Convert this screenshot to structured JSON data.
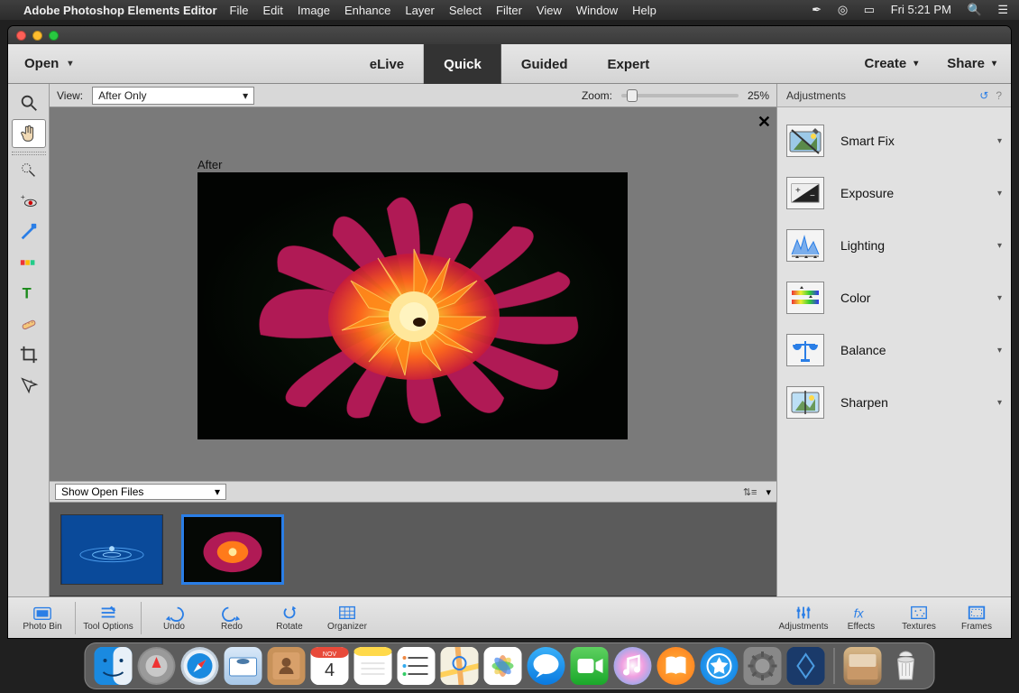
{
  "menubar": {
    "appname": "Adobe Photoshop Elements Editor",
    "items": [
      "File",
      "Edit",
      "Image",
      "Enhance",
      "Layer",
      "Select",
      "Filter",
      "View",
      "Window",
      "Help"
    ],
    "clock": "Fri 5:21 PM"
  },
  "toolbar": {
    "open_label": "Open",
    "modes": [
      "eLive",
      "Quick",
      "Guided",
      "Expert"
    ],
    "active_mode": "Quick",
    "create_label": "Create",
    "share_label": "Share"
  },
  "viewbar": {
    "label": "View:",
    "selected": "After Only",
    "zoom_label": "Zoom:",
    "zoom_value": "25%"
  },
  "canvas": {
    "after_label": "After"
  },
  "binbar": {
    "selected": "Show Open Files"
  },
  "rpanel": {
    "title": "Adjustments",
    "items": [
      "Smart Fix",
      "Exposure",
      "Lighting",
      "Color",
      "Balance",
      "Sharpen"
    ]
  },
  "bottombar": {
    "left": [
      "Photo Bin",
      "Tool Options",
      "Undo",
      "Redo",
      "Rotate",
      "Organizer"
    ],
    "right": [
      "Adjustments",
      "Effects",
      "Textures",
      "Frames"
    ]
  },
  "tools": [
    "zoom",
    "hand",
    "lasso",
    "redeye",
    "whiten",
    "quick-select",
    "type",
    "healing",
    "crop",
    "move"
  ]
}
